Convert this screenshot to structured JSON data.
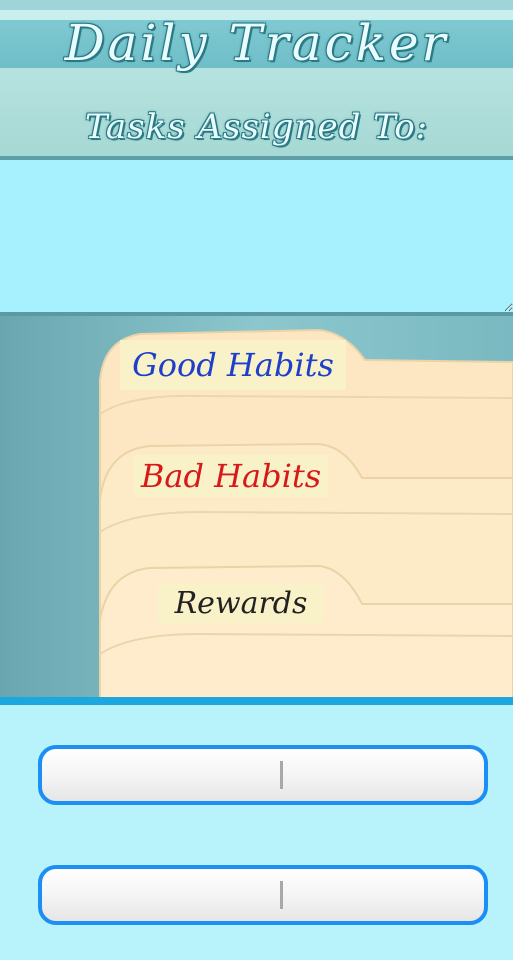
{
  "app": {
    "title": "Daily Tracker",
    "subtitle": "Tasks Assigned To:"
  },
  "assignees": {
    "value": ""
  },
  "folder_tabs": [
    {
      "label": "Good Habits",
      "color": "#1d3fcc"
    },
    {
      "label": "Bad Habits",
      "color": "#d41a1a"
    },
    {
      "label": "Rewards",
      "color": "#222222"
    }
  ],
  "bottom_buttons": [
    {
      "left_label": "",
      "right_label": ""
    },
    {
      "left_label": "",
      "right_label": ""
    }
  ],
  "colors": {
    "accent": "#1b8ff3",
    "divider": "#1ca8de",
    "folder": "#feeac7"
  }
}
